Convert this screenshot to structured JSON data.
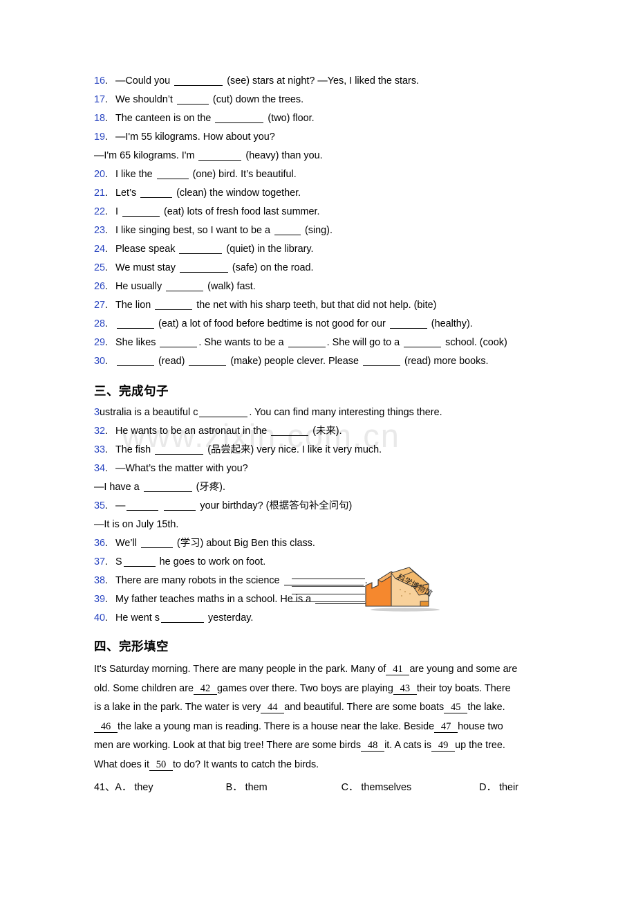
{
  "watermark": "www.zixin.com.cn",
  "section_fill_blank": {
    "items": [
      {
        "num": "16",
        "parts": [
          "—Could you ",
          "BLANK8",
          " (see) stars at night?  —Yes, I liked the stars."
        ]
      },
      {
        "num": "17",
        "parts": [
          "We shouldn’t ",
          "BLANK5",
          " (cut) down the trees."
        ]
      },
      {
        "num": "18",
        "parts": [
          "The canteen is on the ",
          "BLANK8",
          " (two) floor."
        ]
      },
      {
        "num": "19",
        "parts": [
          "—I'm 55 kilograms. How about you?"
        ]
      },
      {
        "num": "",
        "cont": true,
        "parts": [
          "—I'm 65 kilograms. I'm ",
          "BLANK7",
          " (heavy) than you."
        ]
      },
      {
        "num": "20",
        "parts": [
          "I like the ",
          "BLANK5",
          " (one) bird. It’s beautiful."
        ]
      },
      {
        "num": "21",
        "parts": [
          "Let’s ",
          "BLANK5",
          " (clean) the window together."
        ]
      },
      {
        "num": "22",
        "parts": [
          "I ",
          "BLANK6",
          " (eat) lots of fresh food last summer."
        ]
      },
      {
        "num": "23",
        "parts": [
          "I like singing best, so I want to be a ",
          "BLANK4",
          " (sing)."
        ]
      },
      {
        "num": "24",
        "parts": [
          "Please speak ",
          "BLANK7",
          " (quiet) in the library."
        ]
      },
      {
        "num": "25",
        "parts": [
          "We must stay ",
          "BLANK8",
          " (safe) on the road."
        ]
      },
      {
        "num": "26",
        "parts": [
          "He usually ",
          "BLANK6",
          " (walk) fast."
        ]
      },
      {
        "num": "27",
        "parts": [
          "The lion ",
          "BLANK6",
          " the net with his sharp teeth, but that did not help. (bite)"
        ]
      },
      {
        "num": "28",
        "parts": [
          "",
          "BLANK6",
          " (eat) a lot of food before bedtime is not good for our ",
          "BLANK6",
          " (healthy)."
        ]
      },
      {
        "num": "29",
        "parts": [
          "She likes ",
          "BLANK6",
          ". She wants to be a ",
          "BLANK6",
          ". She will go to a ",
          "BLANK6",
          " school. (cook)"
        ]
      },
      {
        "num": "30",
        "parts": [
          "",
          "BLANK6",
          " (read) ",
          "BLANK6",
          " (make) people clever. Please ",
          "BLANK6",
          " (read) more books."
        ]
      }
    ]
  },
  "section_complete_sentence": {
    "heading": "三、完成句子",
    "items": [
      {
        "num": "3",
        "glued": true,
        "parts": [
          "ustralia is a beautiful c",
          "BLANK8",
          ". You can find many interesting things there."
        ]
      },
      {
        "num": "32",
        "parts": [
          "He wants to be an astronaut in the ",
          "BLANK6",
          " (未来)."
        ]
      },
      {
        "num": "33",
        "parts": [
          "The fish ",
          "BLANK8",
          " (品尝起来) very nice. I like it very much."
        ]
      },
      {
        "num": "34",
        "parts": [
          "—What’s the matter with you?"
        ]
      },
      {
        "num": "",
        "cont": true,
        "parts": [
          "—I have a ",
          "BLANK8",
          " (牙疼)."
        ]
      },
      {
        "num": "35",
        "parts": [
          "—",
          "BLANK5",
          " ",
          "BLANK5",
          " your birthday? (根据答句补全问句)"
        ]
      },
      {
        "num": "",
        "cont": true,
        "parts": [
          "—It is on July 15th."
        ]
      },
      {
        "num": "36",
        "parts": [
          "We’ll ",
          "BLANK5",
          " (学习) about Big Ben this class."
        ]
      },
      {
        "num": "37",
        "parts": [
          "S",
          "BLANK5",
          " he goes to work on foot."
        ]
      },
      {
        "num": "38",
        "parts": [
          "There are many robots in the science ",
          "BLANK13",
          "."
        ]
      },
      {
        "num": "39",
        "parts": [
          "My father teaches maths in a school. He is a ",
          "BLANK13",
          "."
        ]
      },
      {
        "num": "40",
        "parts": [
          "He went s",
          "BLANK7",
          " yesterday."
        ]
      }
    ],
    "illustration": {
      "name": "science-museum-building",
      "label": "科学博物馆",
      "color_left": "#F5882E",
      "color_right": "#F8D19B",
      "color_outline": "#3a3a3a"
    }
  },
  "section_cloze": {
    "heading": "四、完形填空",
    "lines": [
      [
        {
          "t": "It's Saturday morning. There are many people in the park. Many of"
        },
        {
          "blank": "41"
        },
        {
          "t": "are young and some are"
        }
      ],
      [
        {
          "t": "old. Some children are"
        },
        {
          "blank": "42"
        },
        {
          "t": "games over there. Two boys are playing"
        },
        {
          "blank": "43"
        },
        {
          "t": "their toy boats. There"
        }
      ],
      [
        {
          "t": "is a lake in the park. The water is very"
        },
        {
          "blank": "44"
        },
        {
          "t": "and beautiful. There are some boats"
        },
        {
          "blank": "45"
        },
        {
          "t": "the lake."
        }
      ],
      [
        {
          "blank": "46"
        },
        {
          "t": "the lake a young man is reading. There is a house near the lake. Beside"
        },
        {
          "blank": "47"
        },
        {
          "t": "house two"
        }
      ],
      [
        {
          "t": "men are working. Look at that big tree! There are some birds"
        },
        {
          "blank": "48"
        },
        {
          "t": "it. A cats is"
        },
        {
          "blank": "49"
        },
        {
          "t": "up the tree."
        }
      ],
      [
        {
          "t": "What does it"
        },
        {
          "blank": "50"
        },
        {
          "t": "to do? It wants to catch the birds."
        }
      ]
    ],
    "question_options": {
      "number": "41、",
      "options": [
        {
          "letter": "A．",
          "text": "they"
        },
        {
          "letter": "B．",
          "text": "them"
        },
        {
          "letter": "C．",
          "text": "themselves"
        },
        {
          "letter": "D．",
          "text": "their"
        }
      ]
    }
  }
}
